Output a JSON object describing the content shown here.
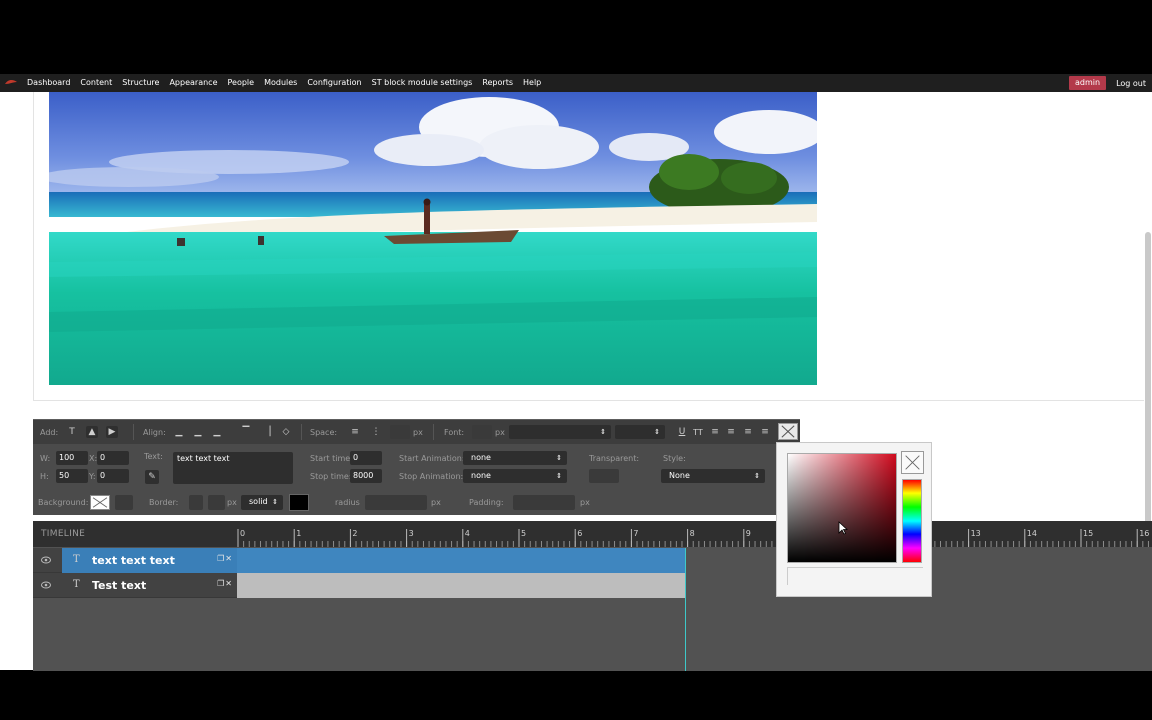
{
  "toolbar": {
    "items": [
      "Dashboard",
      "Content",
      "Structure",
      "Appearance",
      "People",
      "Modules",
      "Configuration",
      "ST block module settings",
      "Reports",
      "Help"
    ],
    "user": "admin",
    "logout": "Log out"
  },
  "editor": {
    "add_label": "Add:",
    "align_label": "Align:",
    "space_label": "Space:",
    "space_unit": "px",
    "font_label": "Font:",
    "font_unit": "px",
    "w_label": "W:",
    "w_value": "100",
    "h_label": "H:",
    "h_value": "50",
    "x_label": "X:",
    "x_value": "0",
    "y_label": "Y:",
    "y_value": "0",
    "text_label": "Text:",
    "text_value": "text text text",
    "start_time_label": "Start time:",
    "start_time_value": "0",
    "stop_time_label": "Stop time:",
    "stop_time_value": "8000",
    "start_anim_label": "Start Animation:",
    "start_anim_value": "none",
    "stop_anim_label": "Stop Animation:",
    "stop_anim_value": "none",
    "transparent_label": "Transparent:",
    "style_label": "Style:",
    "style_value": "None",
    "background_label": "Background:",
    "border_label": "Border:",
    "border_unit": "px",
    "border_style": "solid",
    "radius_label": "radius",
    "radius_unit": "px",
    "padding_label": "Padding:",
    "padding_unit": "px",
    "border_color": "#000000"
  },
  "timeline": {
    "title": "TIMELINE",
    "ticks": [
      "0",
      "1",
      "2",
      "3",
      "4",
      "5",
      "6",
      "7",
      "8",
      "9",
      "13",
      "14",
      "15",
      "16"
    ],
    "layers": [
      {
        "type_icon": "T",
        "name": "text text text",
        "active": true
      },
      {
        "type_icon": "T",
        "name": "Test text",
        "active": false
      }
    ]
  },
  "colors": {
    "toolbar_bg": "#1f1f1f",
    "admin_badge": "#b3394a",
    "active_layer": "#3a7fb8",
    "playhead": "#3ec9c9",
    "picker_hue": "#d00a1e"
  }
}
